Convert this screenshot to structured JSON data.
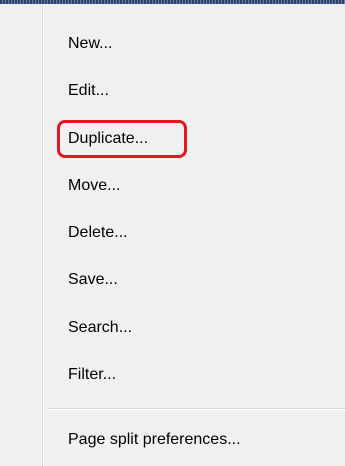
{
  "menu": {
    "items": [
      {
        "label": "New..."
      },
      {
        "label": "Edit..."
      },
      {
        "label": "Duplicate..."
      },
      {
        "label": "Move..."
      },
      {
        "label": "Delete..."
      },
      {
        "label": "Save..."
      },
      {
        "label": "Search..."
      },
      {
        "label": "Filter..."
      }
    ],
    "footer_item": {
      "label": "Page split preferences..."
    },
    "highlighted_item": "Duplicate...",
    "highlight_color": "#e3171d"
  }
}
